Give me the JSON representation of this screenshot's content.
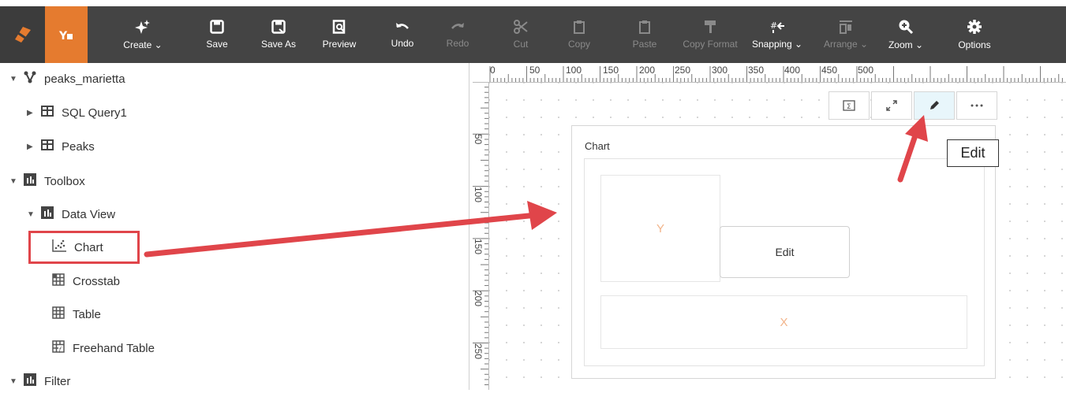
{
  "toolbar": {
    "buttons": [
      {
        "label": "Create ⌄",
        "icon": "sparkle-icon",
        "enabled": true
      },
      {
        "label": "Save",
        "icon": "save-icon",
        "enabled": true
      },
      {
        "label": "Save As",
        "icon": "save-as-icon",
        "enabled": true
      },
      {
        "label": "Preview",
        "icon": "preview-icon",
        "enabled": true
      },
      {
        "label": "Undo",
        "icon": "undo-icon",
        "enabled": true
      },
      {
        "label": "Redo",
        "icon": "redo-icon",
        "enabled": false
      },
      {
        "label": "Cut",
        "icon": "cut-icon",
        "enabled": false
      },
      {
        "label": "Copy",
        "icon": "copy-icon",
        "enabled": false
      },
      {
        "label": "Paste",
        "icon": "paste-icon",
        "enabled": false
      },
      {
        "label": "Copy Format",
        "icon": "copy-format-icon",
        "enabled": false
      },
      {
        "label": "Snapping ⌄",
        "icon": "snapping-icon",
        "enabled": true
      },
      {
        "label": "Arrange ⌄",
        "icon": "arrange-icon",
        "enabled": false
      },
      {
        "label": "Zoom ⌄",
        "icon": "zoom-icon",
        "enabled": true
      },
      {
        "label": "Options",
        "icon": "gear-icon",
        "enabled": true
      }
    ],
    "colors": {
      "bar": "#444444",
      "accent": "#e57b2f",
      "disabled": "#8a8a8a"
    }
  },
  "tree": {
    "items": [
      {
        "label": "peaks_marietta",
        "icon": "datasource-icon"
      },
      {
        "label": "SQL Query1",
        "icon": "table-grid-icon"
      },
      {
        "label": "Peaks",
        "icon": "table-grid-icon"
      },
      {
        "label": "Toolbox",
        "icon": "toolbox-icon"
      },
      {
        "label": "Data View",
        "icon": "toolbox-icon"
      },
      {
        "label": "Chart",
        "icon": "scatter-chart-icon"
      },
      {
        "label": "Crosstab",
        "icon": "crosstab-icon"
      },
      {
        "label": "Table",
        "icon": "table-icon"
      },
      {
        "label": "Freehand Table",
        "icon": "freehand-table-icon"
      },
      {
        "label": "Filter",
        "icon": "toolbox-icon"
      }
    ]
  },
  "ruler": {
    "h_labels": [
      "0",
      "50",
      "100",
      "150",
      "200",
      "250",
      "300",
      "350",
      "400",
      "450",
      "500"
    ],
    "v_labels": [
      "50",
      "100",
      "150",
      "200",
      "250"
    ]
  },
  "widget": {
    "title": "Chart",
    "y_zone": "Y",
    "x_zone": "X",
    "edit_label": "Edit"
  },
  "tooltip": {
    "text": "Edit"
  },
  "annotation_color": "#e0454a"
}
